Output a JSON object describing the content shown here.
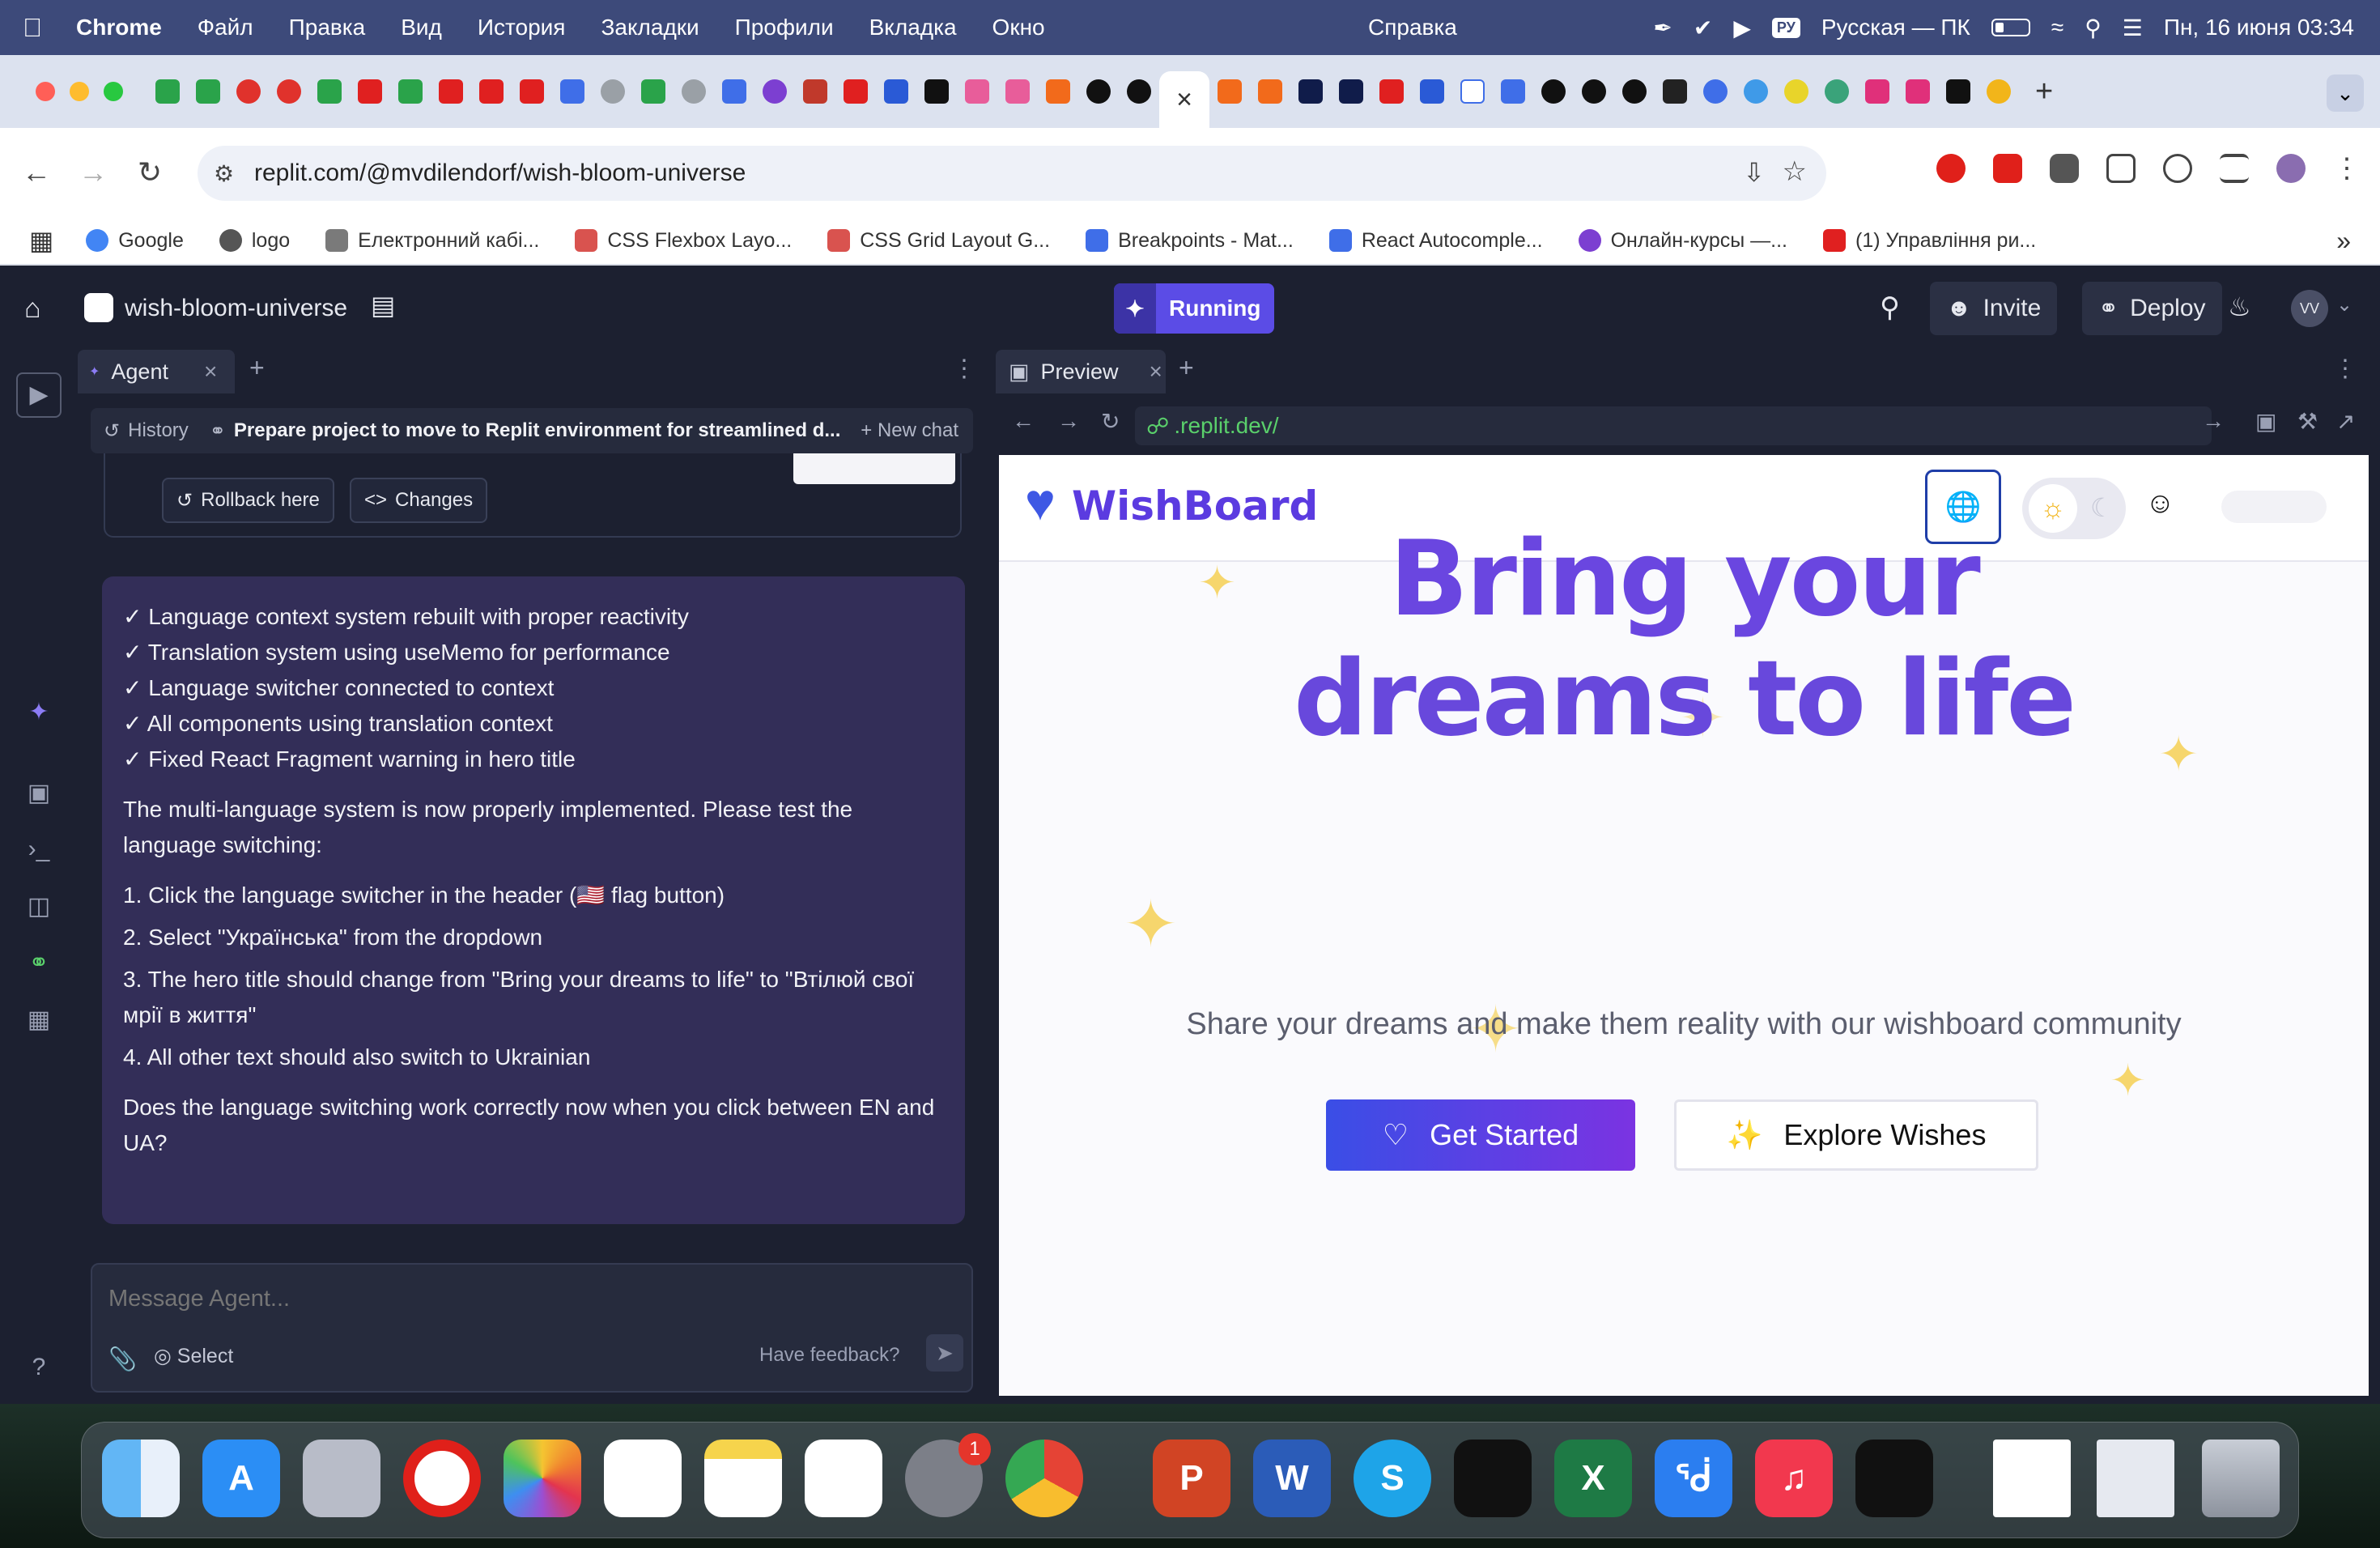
{
  "menubar": {
    "app": "Chrome",
    "items": [
      "Файл",
      "Правка",
      "Вид",
      "История",
      "Закладки",
      "Профили",
      "Вкладка",
      "Окно"
    ],
    "help": "Справка",
    "input_source": "Русская — ПК",
    "keyboard_badge": "РУ",
    "datetime": "Пн, 16 июня  03:34"
  },
  "browser": {
    "url": "replit.com/@mvdilendorf/wish-bloom-universe",
    "active_tab_icon": "close-icon",
    "bookmarks": [
      {
        "label": "Google",
        "color": "#4285f4"
      },
      {
        "label": "logo",
        "color": "#555"
      },
      {
        "label": "Електронний кабі...",
        "color": "#7a7a7a"
      },
      {
        "label": "CSS Flexbox Layo...",
        "color": "#d9534f"
      },
      {
        "label": "CSS Grid Layout G...",
        "color": "#d9534f"
      },
      {
        "label": "Breakpoints - Mat...",
        "color": "#3f6ee8"
      },
      {
        "label": "React Autocomple...",
        "color": "#3f6ee8"
      },
      {
        "label": "Онлайн-курсы —...",
        "color": "#7c3fd1"
      },
      {
        "label": "(1) Управління ри...",
        "color": "#e02020"
      }
    ]
  },
  "replit": {
    "project": "wish-bloom-universe",
    "status": "Running",
    "invite": "Invite",
    "deploy": "Deploy",
    "avatar": "VV",
    "agent_tab": "Agent",
    "history": "History",
    "chat_title": "Prepare project to move to Replit environment for streamlined d...",
    "new_chat": "New chat",
    "rollback": "Rollback here",
    "changes": "Changes",
    "checklist": [
      "✓ Language context system rebuilt with proper reactivity",
      "✓ Translation system using useMemo for performance",
      "✓ Language switcher connected to context",
      "✓ All components using translation context",
      "✓ Fixed React Fragment warning in hero title"
    ],
    "para1": "The multi-language system is now properly implemented. Please test the language switching:",
    "steps": [
      "1. Click the language switcher in the header (🇺🇸 flag button)",
      "2. Select \"Українська\" from the dropdown",
      "3. The hero title should change from \"Bring your dreams to life\" to \"Втілюй свої мрії в життя\"",
      "4. All other text should also switch to Ukrainian"
    ],
    "question": "Does the language switching work correctly now when you click between EN and UA?",
    "message_placeholder": "Message Agent...",
    "select": "Select",
    "feedback": "Have feedback?",
    "preview_tab": "Preview",
    "preview_url": ".replit.dev/"
  },
  "site": {
    "logo": "WishBoard",
    "hero_line1": "Bring your",
    "hero_line2": "dreams to life",
    "subtitle": "Share your dreams and make them reality with our wishboard community",
    "primary_cta": "Get Started",
    "secondary_cta": "Explore Wishes",
    "colors": {
      "accent": "#5b3be0",
      "button_start": "#3a4ee6",
      "button_end": "#7b33e2"
    }
  },
  "dock": {
    "badge": "1",
    "apps": [
      "finder",
      "app-store",
      "launchpad",
      "opera",
      "photos",
      "reminders",
      "notes",
      "freeform",
      "system-settings",
      "chrome",
      "powerpoint",
      "word",
      "skype",
      "stocks",
      "excel",
      "bluetooth",
      "music",
      "sketchup",
      "trash"
    ]
  }
}
